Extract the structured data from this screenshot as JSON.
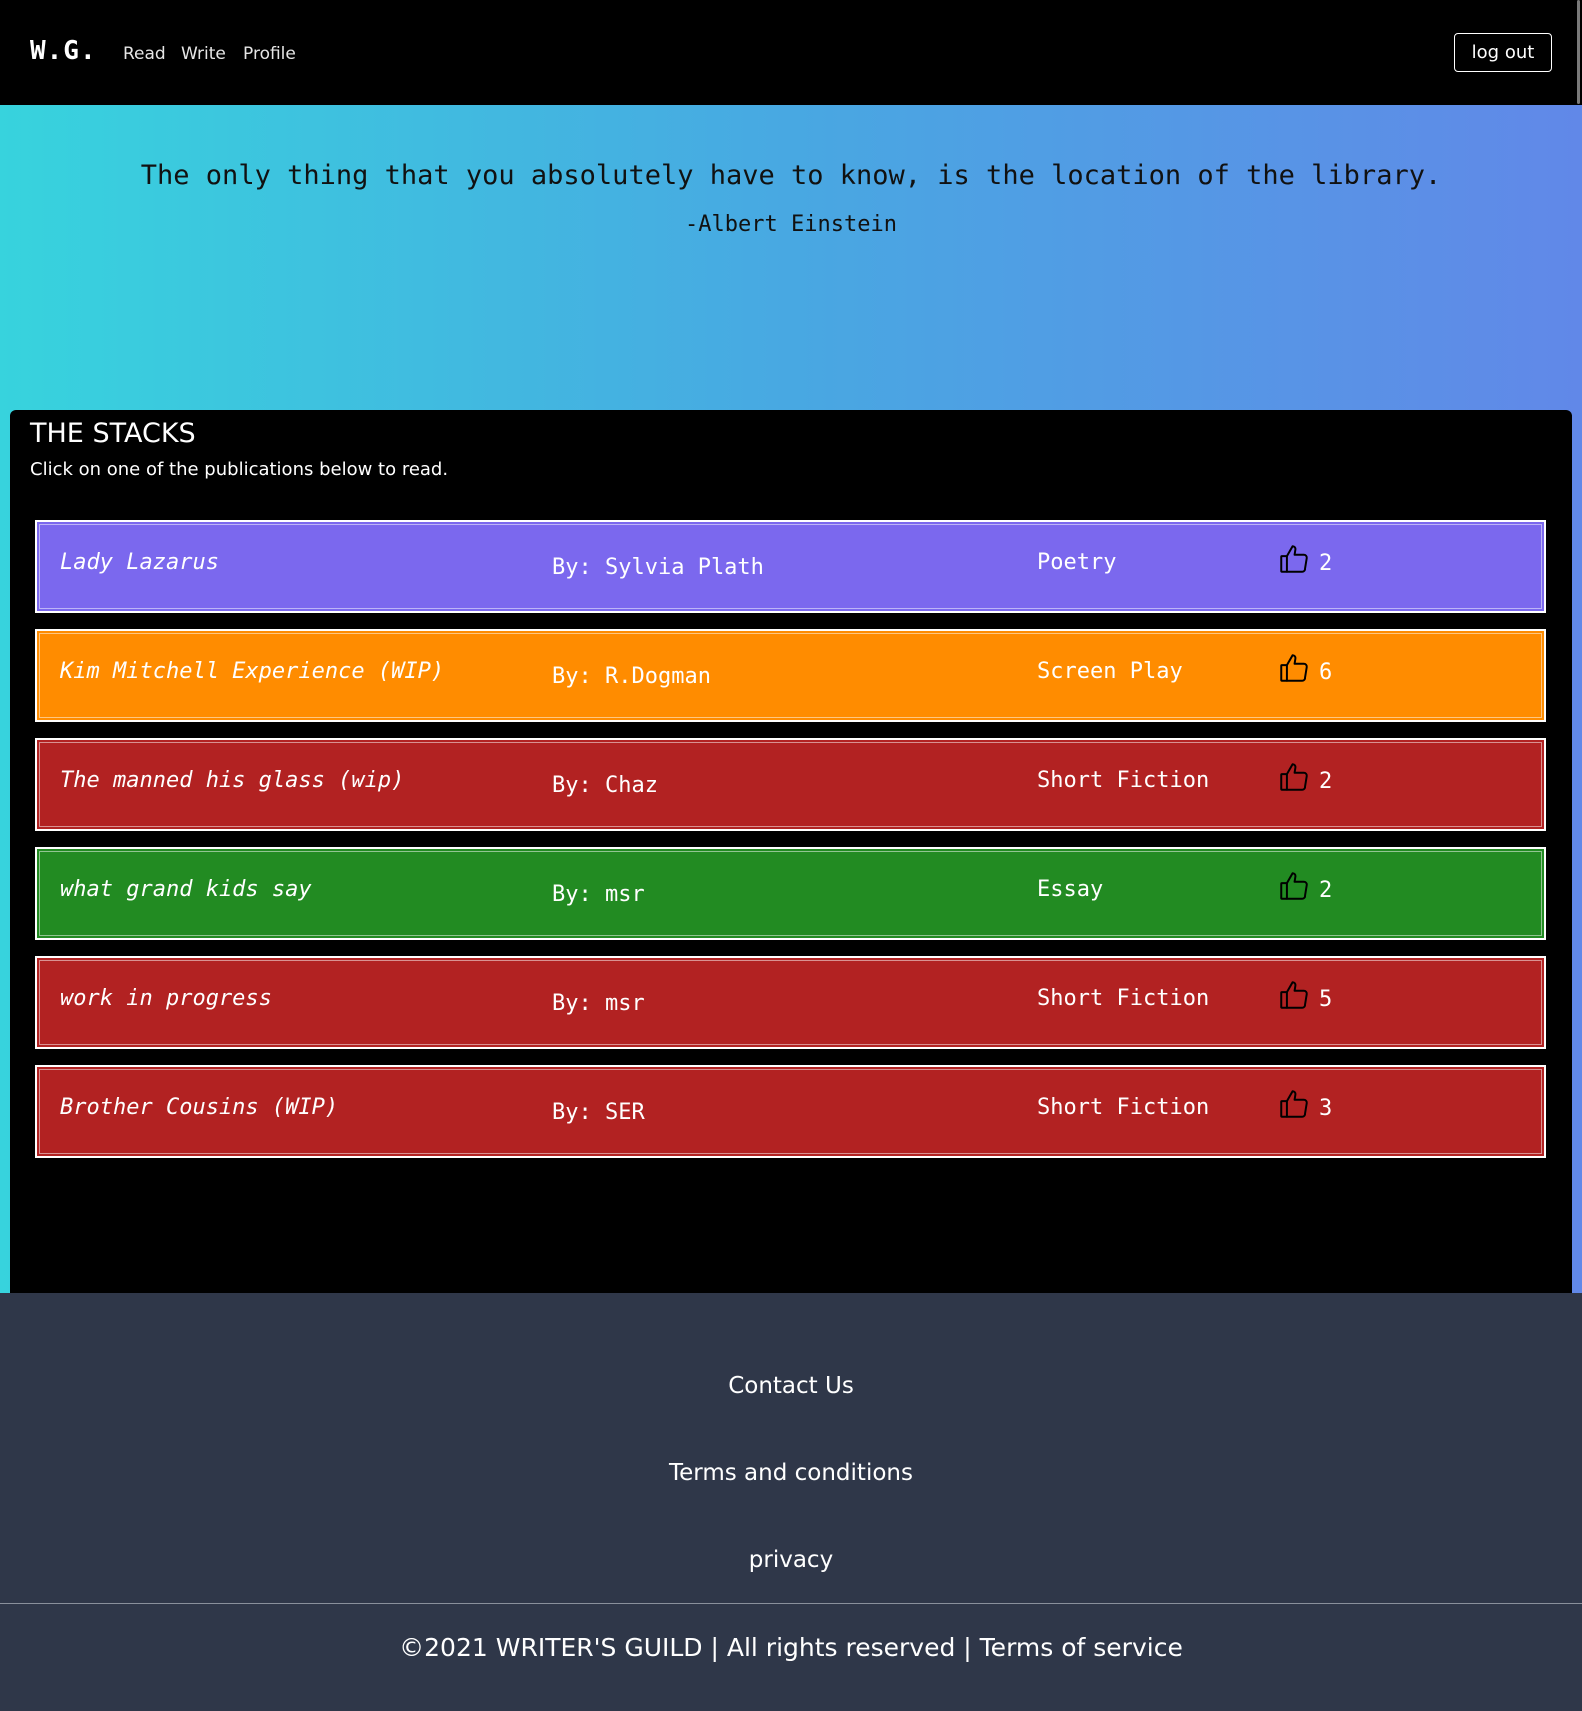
{
  "nav": {
    "brand": "W.G.",
    "links": [
      "Read",
      "Write",
      "Profile"
    ],
    "logout_label": "log out"
  },
  "hero": {
    "quote": "The only thing that you absolutely have to know, is the location of the library.",
    "author": "-Albert Einstein"
  },
  "stacks": {
    "title": "THE STACKS",
    "subtitle": "Click on one of the publications below to read.",
    "publications": [
      {
        "title": "Lady Lazarus",
        "author": "By: Sylvia Plath",
        "genre": "Poetry",
        "likes": "2",
        "color": "#7b68ee"
      },
      {
        "title": "Kim Mitchell Experience (WIP)",
        "author": "By: R.Dogman",
        "genre": "Screen Play",
        "likes": "6",
        "color": "#ff8c00"
      },
      {
        "title": "The manned his glass (wip)",
        "author": "By: Chaz",
        "genre": "Short Fiction",
        "likes": "2",
        "color": "#b22222"
      },
      {
        "title": "what grand kids say",
        "author": "By: msr",
        "genre": "Essay",
        "likes": "2",
        "color": "#228b22"
      },
      {
        "title": "work in progress",
        "author": "By: msr",
        "genre": "Short Fiction",
        "likes": "5",
        "color": "#b22222"
      },
      {
        "title": "Brother Cousins (WIP)",
        "author": "By: SER",
        "genre": "Short Fiction",
        "likes": "3",
        "color": "#b22222"
      }
    ],
    "like_icon": "thumbs-up-icon"
  },
  "footer": {
    "links": [
      "Contact Us",
      "Terms and conditions",
      "privacy"
    ],
    "copyright": "©2021 WRITER'S GUILD | All rights reserved | Terms of service"
  }
}
